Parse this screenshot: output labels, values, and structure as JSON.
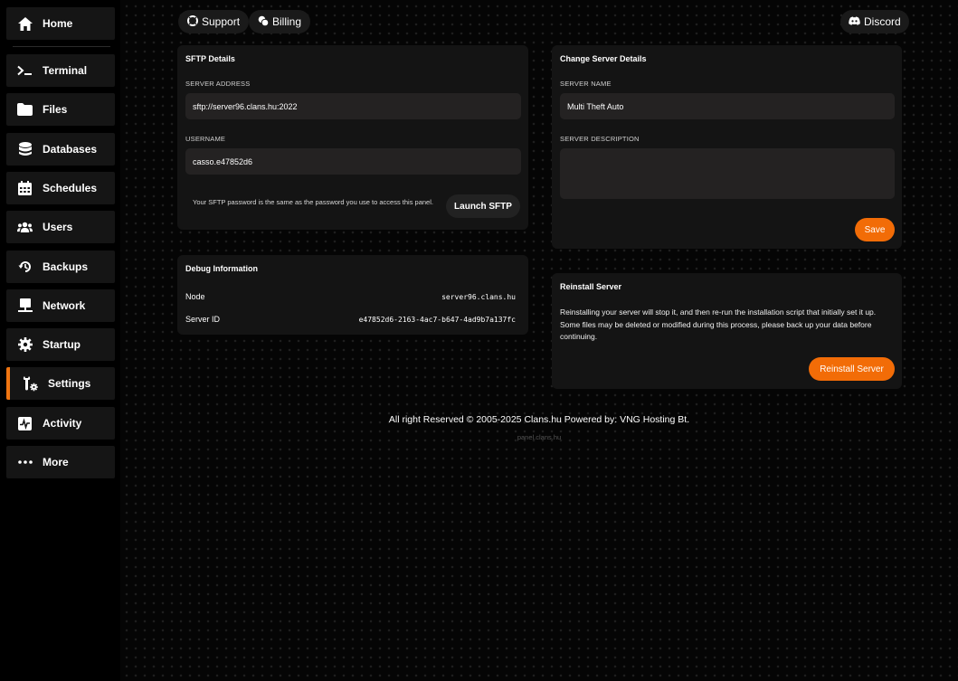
{
  "sidebar": {
    "items": [
      {
        "label": "Home",
        "icon": "home-icon"
      },
      {
        "label": "Terminal",
        "icon": "terminal-icon"
      },
      {
        "label": "Files",
        "icon": "folder-icon"
      },
      {
        "label": "Databases",
        "icon": "database-icon"
      },
      {
        "label": "Schedules",
        "icon": "calendar-icon"
      },
      {
        "label": "Users",
        "icon": "users-icon"
      },
      {
        "label": "Backups",
        "icon": "backup-icon"
      },
      {
        "label": "Network",
        "icon": "network-icon"
      },
      {
        "label": "Startup",
        "icon": "startup-icon"
      },
      {
        "label": "Settings",
        "icon": "settings-icon"
      },
      {
        "label": "Activity",
        "icon": "activity-icon"
      },
      {
        "label": "More",
        "icon": "more-icon"
      }
    ],
    "active": "Settings",
    "accent_color": "#f07511"
  },
  "topbar": {
    "support_label": "Support",
    "billing_label": "Billing",
    "discord_label": "Discord"
  },
  "sftp": {
    "title": "SFTP Details",
    "server_address_label": "SERVER ADDRESS",
    "server_address_value": "sftp://server96.clans.hu:2022",
    "username_label": "USERNAME",
    "username_value": "casso.e47852d6",
    "note": "Your SFTP password is the same as the password you use to access this panel.",
    "launch_label": "Launch SFTP"
  },
  "debug": {
    "title": "Debug Information",
    "node_label": "Node",
    "node_value": "server96.clans.hu",
    "server_id_label": "Server ID",
    "server_id_value": "e47852d6-2163-4ac7-b647-4ad9b7a137fc"
  },
  "change_details": {
    "title": "Change Server Details",
    "server_name_label": "SERVER NAME",
    "server_name_value": "Multi Theft Auto",
    "server_description_label": "SERVER DESCRIPTION",
    "server_description_value": "",
    "save_label": "Save"
  },
  "reinstall": {
    "title": "Reinstall Server",
    "description": "Reinstalling your server will stop it, and then re-run the installation script that initially set it up. Some files may be deleted or modified during this process, please back up your data before continuing.",
    "button_label": "Reinstall Server"
  },
  "footer": {
    "copyright": "All right Reserved © 2005-2025 Clans.hu Powered by: VNG Hosting Bt.",
    "host": "panel.clans.hu"
  },
  "colors": {
    "accent": "#f26c07",
    "card": "#141414",
    "input": "#242222"
  }
}
